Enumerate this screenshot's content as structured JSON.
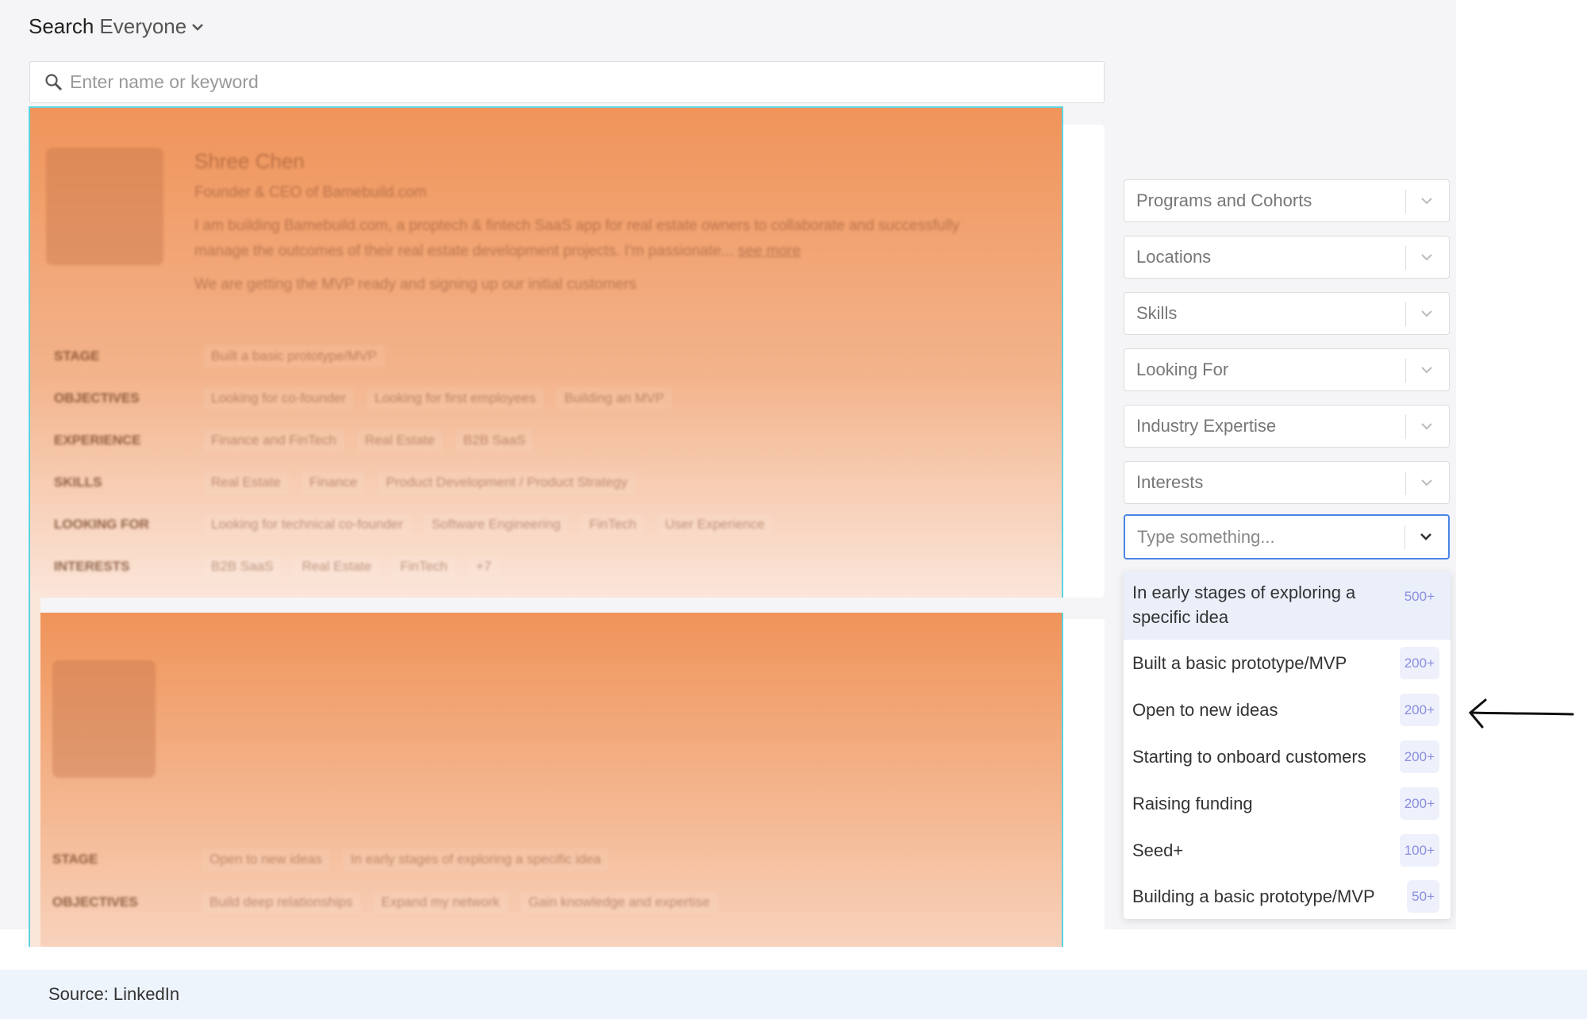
{
  "header": {
    "search_label": "Search",
    "scope": "Everyone"
  },
  "search": {
    "placeholder": "Enter name or keyword"
  },
  "cards": [
    {
      "name": "Shree Chen",
      "title": "Founder & CEO of Bamebuild.com",
      "bio_line1": "I am building Bamebuild.com, a proptech & fintech SaaS app for real estate owners to collaborate and successfully",
      "bio_line2": "manage the outcomes of their real estate development projects. I'm passionate...",
      "see_more": "see more",
      "status": "We are getting the MVP ready and signing up our initial customers",
      "rows": [
        {
          "label": "STAGE",
          "chips": [
            "Built a basic prototype/MVP"
          ]
        },
        {
          "label": "OBJECTIVES",
          "chips": [
            "Looking for co-founder",
            "Looking for first employees",
            "Building an MVP"
          ]
        },
        {
          "label": "EXPERIENCE",
          "chips": [
            "Finance and FinTech",
            "Real Estate",
            "B2B SaaS"
          ]
        },
        {
          "label": "SKILLS",
          "chips": [
            "Real Estate",
            "Finance",
            "Product Development / Product Strategy"
          ]
        },
        {
          "label": "LOOKING FOR",
          "chips": [
            "Looking for technical co-founder",
            "Software Engineering",
            "FinTech",
            "User Experience"
          ]
        },
        {
          "label": "INTERESTS",
          "chips": [
            "B2B SaaS",
            "Real Estate",
            "FinTech",
            "+7"
          ]
        }
      ]
    },
    {
      "rows": [
        {
          "label": "STAGE",
          "chips": [
            "Open to new ideas",
            "In early stages of exploring a specific idea"
          ]
        },
        {
          "label": "OBJECTIVES",
          "chips": [
            "Build deep relationships",
            "Expand my network",
            "Gain knowledge and expertise"
          ]
        }
      ]
    }
  ],
  "filters": [
    "Programs and Cohorts",
    "Locations",
    "Skills",
    "Looking For",
    "Industry Expertise",
    "Interests"
  ],
  "stage_filter": {
    "placeholder": "Type something..."
  },
  "stage_options": [
    {
      "label": "In early stages of exploring a specific idea",
      "count": "500+"
    },
    {
      "label": "Built a basic prototype/MVP",
      "count": "200+"
    },
    {
      "label": "Open to new ideas",
      "count": "200+"
    },
    {
      "label": "Starting to onboard customers",
      "count": "200+"
    },
    {
      "label": "Raising funding",
      "count": "200+"
    },
    {
      "label": "Seed+",
      "count": "100+"
    },
    {
      "label": "Building a basic prototype/MVP",
      "count": "50+"
    }
  ],
  "footer": {
    "source": "Source: LinkedIn"
  }
}
